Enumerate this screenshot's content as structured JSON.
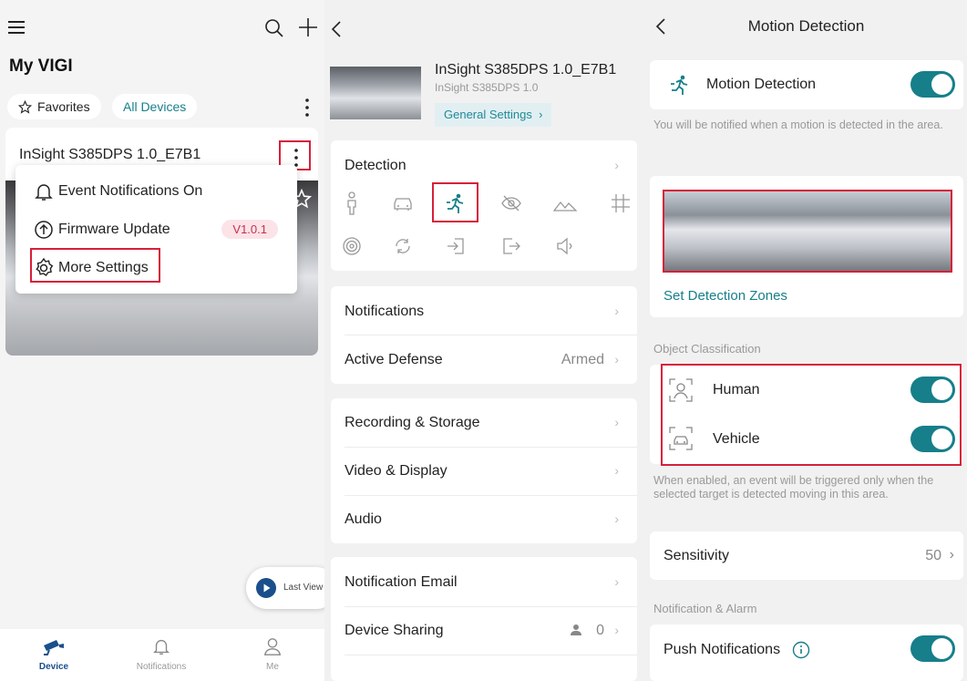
{
  "left_panel": {
    "title": "My VIGI",
    "favorites_label": "Favorites",
    "all_devices_label": "All Devices",
    "device_name": "InSight S385DPS 1.0_E7B1",
    "menu": {
      "event_notifications": "Event Notifications On",
      "firmware_update": "Firmware Update",
      "firmware_version": "V1.0.1",
      "more_settings": "More Settings"
    },
    "last_view_label": "Last View",
    "tabs": [
      {
        "label": "Device",
        "icon": "camera-icon"
      },
      {
        "label": "Notifications",
        "icon": "bell-icon"
      },
      {
        "label": "Me",
        "icon": "user-icon"
      }
    ]
  },
  "middle_panel": {
    "device_name": "InSight S385DPS 1.0_E7B1",
    "device_model": "InSight S385DPS 1.0",
    "general_settings": "General Settings",
    "detection_label": "Detection",
    "rows": {
      "notifications": "Notifications",
      "active_defense": "Active Defense",
      "active_defense_value": "Armed",
      "recording_storage": "Recording & Storage",
      "video_display": "Video & Display",
      "audio": "Audio",
      "notification_email": "Notification Email",
      "device_sharing": "Device Sharing",
      "device_sharing_count": "0"
    }
  },
  "right_panel": {
    "title": "Motion Detection",
    "motion_detection_label": "Motion Detection",
    "motion_note": "You will be notified when a motion is detected in the area.",
    "set_zones": "Set Detection Zones",
    "object_classification": "Object Classification",
    "human": "Human",
    "vehicle": "Vehicle",
    "classification_note": "When enabled, an event will be triggered only when the selected target is detected moving in this area.",
    "sensitivity": "Sensitivity",
    "sensitivity_value": "50",
    "notification_alarm": "Notification & Alarm",
    "push_notifications": "Push Notifications"
  },
  "colors": {
    "accent": "#167f8a",
    "highlight_red": "#d6203a",
    "brand_blue": "#1a4f8b"
  }
}
